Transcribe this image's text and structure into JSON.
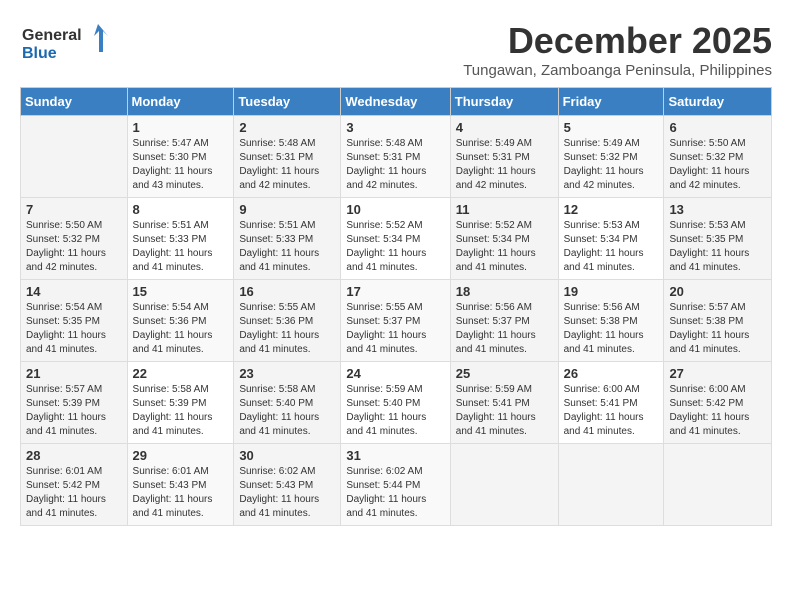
{
  "logo": {
    "line1": "General",
    "line2": "Blue"
  },
  "title": "December 2025",
  "location": "Tungawan, Zamboanga Peninsula, Philippines",
  "days_header": [
    "Sunday",
    "Monday",
    "Tuesday",
    "Wednesday",
    "Thursday",
    "Friday",
    "Saturday"
  ],
  "weeks": [
    [
      {
        "day": "",
        "sunrise": "",
        "sunset": "",
        "daylight": ""
      },
      {
        "day": "1",
        "sunrise": "Sunrise: 5:47 AM",
        "sunset": "Sunset: 5:30 PM",
        "daylight": "Daylight: 11 hours and 43 minutes."
      },
      {
        "day": "2",
        "sunrise": "Sunrise: 5:48 AM",
        "sunset": "Sunset: 5:31 PM",
        "daylight": "Daylight: 11 hours and 42 minutes."
      },
      {
        "day": "3",
        "sunrise": "Sunrise: 5:48 AM",
        "sunset": "Sunset: 5:31 PM",
        "daylight": "Daylight: 11 hours and 42 minutes."
      },
      {
        "day": "4",
        "sunrise": "Sunrise: 5:49 AM",
        "sunset": "Sunset: 5:31 PM",
        "daylight": "Daylight: 11 hours and 42 minutes."
      },
      {
        "day": "5",
        "sunrise": "Sunrise: 5:49 AM",
        "sunset": "Sunset: 5:32 PM",
        "daylight": "Daylight: 11 hours and 42 minutes."
      },
      {
        "day": "6",
        "sunrise": "Sunrise: 5:50 AM",
        "sunset": "Sunset: 5:32 PM",
        "daylight": "Daylight: 11 hours and 42 minutes."
      }
    ],
    [
      {
        "day": "7",
        "sunrise": "Sunrise: 5:50 AM",
        "sunset": "Sunset: 5:32 PM",
        "daylight": "Daylight: 11 hours and 42 minutes."
      },
      {
        "day": "8",
        "sunrise": "Sunrise: 5:51 AM",
        "sunset": "Sunset: 5:33 PM",
        "daylight": "Daylight: 11 hours and 41 minutes."
      },
      {
        "day": "9",
        "sunrise": "Sunrise: 5:51 AM",
        "sunset": "Sunset: 5:33 PM",
        "daylight": "Daylight: 11 hours and 41 minutes."
      },
      {
        "day": "10",
        "sunrise": "Sunrise: 5:52 AM",
        "sunset": "Sunset: 5:34 PM",
        "daylight": "Daylight: 11 hours and 41 minutes."
      },
      {
        "day": "11",
        "sunrise": "Sunrise: 5:52 AM",
        "sunset": "Sunset: 5:34 PM",
        "daylight": "Daylight: 11 hours and 41 minutes."
      },
      {
        "day": "12",
        "sunrise": "Sunrise: 5:53 AM",
        "sunset": "Sunset: 5:34 PM",
        "daylight": "Daylight: 11 hours and 41 minutes."
      },
      {
        "day": "13",
        "sunrise": "Sunrise: 5:53 AM",
        "sunset": "Sunset: 5:35 PM",
        "daylight": "Daylight: 11 hours and 41 minutes."
      }
    ],
    [
      {
        "day": "14",
        "sunrise": "Sunrise: 5:54 AM",
        "sunset": "Sunset: 5:35 PM",
        "daylight": "Daylight: 11 hours and 41 minutes."
      },
      {
        "day": "15",
        "sunrise": "Sunrise: 5:54 AM",
        "sunset": "Sunset: 5:36 PM",
        "daylight": "Daylight: 11 hours and 41 minutes."
      },
      {
        "day": "16",
        "sunrise": "Sunrise: 5:55 AM",
        "sunset": "Sunset: 5:36 PM",
        "daylight": "Daylight: 11 hours and 41 minutes."
      },
      {
        "day": "17",
        "sunrise": "Sunrise: 5:55 AM",
        "sunset": "Sunset: 5:37 PM",
        "daylight": "Daylight: 11 hours and 41 minutes."
      },
      {
        "day": "18",
        "sunrise": "Sunrise: 5:56 AM",
        "sunset": "Sunset: 5:37 PM",
        "daylight": "Daylight: 11 hours and 41 minutes."
      },
      {
        "day": "19",
        "sunrise": "Sunrise: 5:56 AM",
        "sunset": "Sunset: 5:38 PM",
        "daylight": "Daylight: 11 hours and 41 minutes."
      },
      {
        "day": "20",
        "sunrise": "Sunrise: 5:57 AM",
        "sunset": "Sunset: 5:38 PM",
        "daylight": "Daylight: 11 hours and 41 minutes."
      }
    ],
    [
      {
        "day": "21",
        "sunrise": "Sunrise: 5:57 AM",
        "sunset": "Sunset: 5:39 PM",
        "daylight": "Daylight: 11 hours and 41 minutes."
      },
      {
        "day": "22",
        "sunrise": "Sunrise: 5:58 AM",
        "sunset": "Sunset: 5:39 PM",
        "daylight": "Daylight: 11 hours and 41 minutes."
      },
      {
        "day": "23",
        "sunrise": "Sunrise: 5:58 AM",
        "sunset": "Sunset: 5:40 PM",
        "daylight": "Daylight: 11 hours and 41 minutes."
      },
      {
        "day": "24",
        "sunrise": "Sunrise: 5:59 AM",
        "sunset": "Sunset: 5:40 PM",
        "daylight": "Daylight: 11 hours and 41 minutes."
      },
      {
        "day": "25",
        "sunrise": "Sunrise: 5:59 AM",
        "sunset": "Sunset: 5:41 PM",
        "daylight": "Daylight: 11 hours and 41 minutes."
      },
      {
        "day": "26",
        "sunrise": "Sunrise: 6:00 AM",
        "sunset": "Sunset: 5:41 PM",
        "daylight": "Daylight: 11 hours and 41 minutes."
      },
      {
        "day": "27",
        "sunrise": "Sunrise: 6:00 AM",
        "sunset": "Sunset: 5:42 PM",
        "daylight": "Daylight: 11 hours and 41 minutes."
      }
    ],
    [
      {
        "day": "28",
        "sunrise": "Sunrise: 6:01 AM",
        "sunset": "Sunset: 5:42 PM",
        "daylight": "Daylight: 11 hours and 41 minutes."
      },
      {
        "day": "29",
        "sunrise": "Sunrise: 6:01 AM",
        "sunset": "Sunset: 5:43 PM",
        "daylight": "Daylight: 11 hours and 41 minutes."
      },
      {
        "day": "30",
        "sunrise": "Sunrise: 6:02 AM",
        "sunset": "Sunset: 5:43 PM",
        "daylight": "Daylight: 11 hours and 41 minutes."
      },
      {
        "day": "31",
        "sunrise": "Sunrise: 6:02 AM",
        "sunset": "Sunset: 5:44 PM",
        "daylight": "Daylight: 11 hours and 41 minutes."
      },
      {
        "day": "",
        "sunrise": "",
        "sunset": "",
        "daylight": ""
      },
      {
        "day": "",
        "sunrise": "",
        "sunset": "",
        "daylight": ""
      },
      {
        "day": "",
        "sunrise": "",
        "sunset": "",
        "daylight": ""
      }
    ]
  ]
}
